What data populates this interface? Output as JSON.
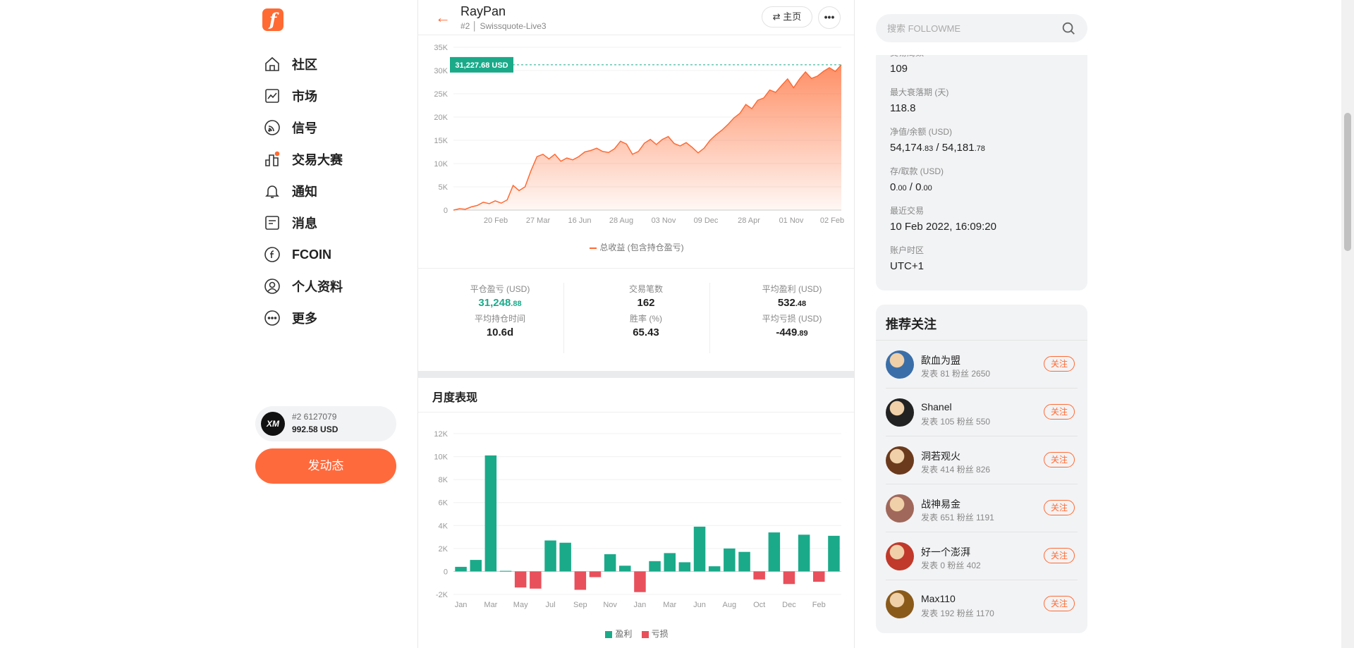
{
  "nav": {
    "logo": "f",
    "items": [
      {
        "label": "社区",
        "icon": "home-icon"
      },
      {
        "label": "市场",
        "icon": "chart-line-icon"
      },
      {
        "label": "信号",
        "icon": "rss-icon"
      },
      {
        "label": "交易大赛",
        "icon": "podium-icon"
      },
      {
        "label": "通知",
        "icon": "bell-icon"
      },
      {
        "label": "消息",
        "icon": "message-icon"
      },
      {
        "label": "FCOIN",
        "icon": "fcoin-icon"
      },
      {
        "label": "个人资料",
        "icon": "user-icon"
      },
      {
        "label": "更多",
        "icon": "more-circle-icon"
      }
    ],
    "account": {
      "avatar": "XM",
      "line1": "#2   6127079",
      "balance": "992.58 USD"
    },
    "post_button": "发动态"
  },
  "header": {
    "back_icon": "←",
    "name": "RayPan",
    "sub": "#2 │ Swissquote-Live3",
    "home_button": "⇄ 主页",
    "more_button": "•••"
  },
  "chart_data": [
    {
      "type": "area",
      "title": "",
      "series": [
        {
          "name": "总收益 (包含持仓盈亏)",
          "color": "#ff6a33"
        }
      ],
      "x_ticks": [
        "20 Feb",
        "27 Mar",
        "16 Jun",
        "28 Aug",
        "03 Nov",
        "09 Dec",
        "28 Apr",
        "01 Nov",
        "02 Feb"
      ],
      "y_ticks": [
        "0",
        "5K",
        "10K",
        "15K",
        "20K",
        "25K",
        "30K",
        "35K"
      ],
      "ylim": [
        0,
        35000
      ],
      "values": [
        0,
        300,
        200,
        700,
        1000,
        1700,
        1400,
        2000,
        1500,
        2200,
        5300,
        4200,
        5000,
        8500,
        11500,
        12000,
        11000,
        12000,
        10500,
        11200,
        10800,
        11500,
        12500,
        12800,
        13300,
        12600,
        12400,
        13200,
        14800,
        14200,
        12000,
        12600,
        14400,
        15200,
        14100,
        15200,
        15800,
        14300,
        13800,
        14500,
        13500,
        12300,
        13300,
        15000,
        16200,
        17200,
        18400,
        19800,
        20800,
        22700,
        21800,
        23600,
        24100,
        25800,
        25300,
        26800,
        28200,
        26300,
        28200,
        29700,
        28300,
        28800,
        29800,
        30600,
        29800,
        31227
      ],
      "last_label": "31,227.68 USD"
    },
    {
      "type": "bar",
      "title": "月度表现",
      "x_ticks": [
        "Jan",
        "Mar",
        "May",
        "Jul",
        "Sep",
        "Nov",
        "Jan",
        "Mar",
        "Jun",
        "Aug",
        "Oct",
        "Dec",
        "Feb"
      ],
      "y_ticks": [
        "-2K",
        "0",
        "2K",
        "4K",
        "6K",
        "8K",
        "10K",
        "12K"
      ],
      "ylim": [
        -2000,
        12000
      ],
      "values": [
        400,
        1000,
        10100,
        50,
        -1400,
        -1500,
        2700,
        2500,
        -1600,
        -500,
        1500,
        500,
        -1800,
        900,
        1600,
        800,
        3900,
        450,
        2000,
        1700,
        -700,
        3400,
        -1100,
        3200,
        -900,
        3100
      ],
      "series": [
        {
          "name": "盈利",
          "color": "#1aaa8a"
        },
        {
          "name": "亏损",
          "color": "#e8505b"
        }
      ]
    }
  ],
  "stats": [
    {
      "label": "平仓盈亏 (USD)",
      "main": "31,248",
      "dec": ".88",
      "color": "#1aaa8a"
    },
    {
      "label": "交易笔数",
      "main": "162",
      "dec": ""
    },
    {
      "label": "平均盈利 (USD)",
      "main": "532",
      "dec": ".48"
    },
    {
      "label": "平均持仓时间",
      "main": "10.6d",
      "dec": ""
    },
    {
      "label": "胜率 (%)",
      "main": "65.43",
      "dec": ""
    },
    {
      "label": "平均亏损 (USD)",
      "main": "-449",
      "dec": ".89"
    }
  ],
  "search": {
    "placeholder": "搜索 FOLLOWME"
  },
  "account_info": [
    {
      "label": "交易周数",
      "main": "109",
      "dec": ""
    },
    {
      "label": "最大衰落期 (天)",
      "main": "118.8",
      "dec": ""
    },
    {
      "label": "净值/余额 (USD)",
      "main": "54,174",
      "dec": ".83",
      "sep": " / ",
      "main2": "54,181",
      "dec2": ".78"
    },
    {
      "label": "存/取款 (USD)",
      "main": "0",
      "dec": ".00",
      "sep": " / ",
      "main2": "0",
      "dec2": ".00"
    },
    {
      "label": "最近交易",
      "main": "10 Feb 2022, 16:09:20",
      "dec": ""
    },
    {
      "label": "账户时区",
      "main": "UTC+1",
      "dec": ""
    }
  ],
  "recommend": {
    "title": "推荐关注",
    "follow_label": "关注",
    "users": [
      {
        "name": "歃血为盟",
        "stats": "发表 81   粉丝 2650",
        "color": "#3a6ea8"
      },
      {
        "name": "Shanel",
        "stats": "发表 105   粉丝 550",
        "color": "#222222"
      },
      {
        "name": "洞若观火",
        "stats": "发表 414   粉丝 826",
        "color": "#6b3a1c"
      },
      {
        "name": "战神易金",
        "stats": "发表 651   粉丝 1191",
        "color": "#a0685a"
      },
      {
        "name": "好一个澎湃",
        "stats": "发表 0   粉丝 402",
        "color": "#c0392b"
      },
      {
        "name": "Max110",
        "stats": "发表 192   粉丝 1170",
        "color": "#8a5a1a"
      }
    ]
  }
}
